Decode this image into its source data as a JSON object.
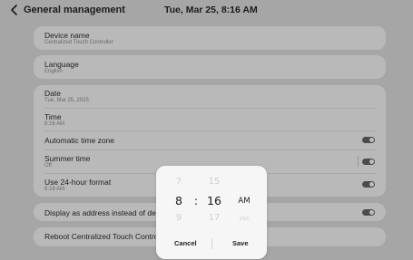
{
  "header": {
    "back_icon": "chevron-left-icon",
    "title": "General management",
    "clock": "Tue, Mar 25, 8:16 AM"
  },
  "device_name": {
    "title": "Device name",
    "value": "Centralized Touch Controller"
  },
  "language": {
    "title": "Language",
    "value": "English"
  },
  "datetime": {
    "date_title": "Date",
    "date_value": "Tue, Mar 25, 2025",
    "time_title": "Time",
    "time_value": "8:16 AM",
    "auto_tz_title": "Automatic time zone",
    "summer_title": "Summer time",
    "summer_value": "Off",
    "format24_title": "Use 24-hour format",
    "format24_value": "8:16 AM"
  },
  "display_address": {
    "title": "Display as address instead of device name"
  },
  "reboot": {
    "title": "Reboot Centralized Touch Controller"
  },
  "picker": {
    "hour_prev": "7",
    "hour_sel": "8",
    "hour_next": "9",
    "colon": ":",
    "minute_prev": "15",
    "minute_sel": "16",
    "minute_next": "17",
    "ampm_sel": "AM",
    "ampm_next": "PM",
    "cancel_label": "Cancel",
    "save_label": "Save"
  }
}
